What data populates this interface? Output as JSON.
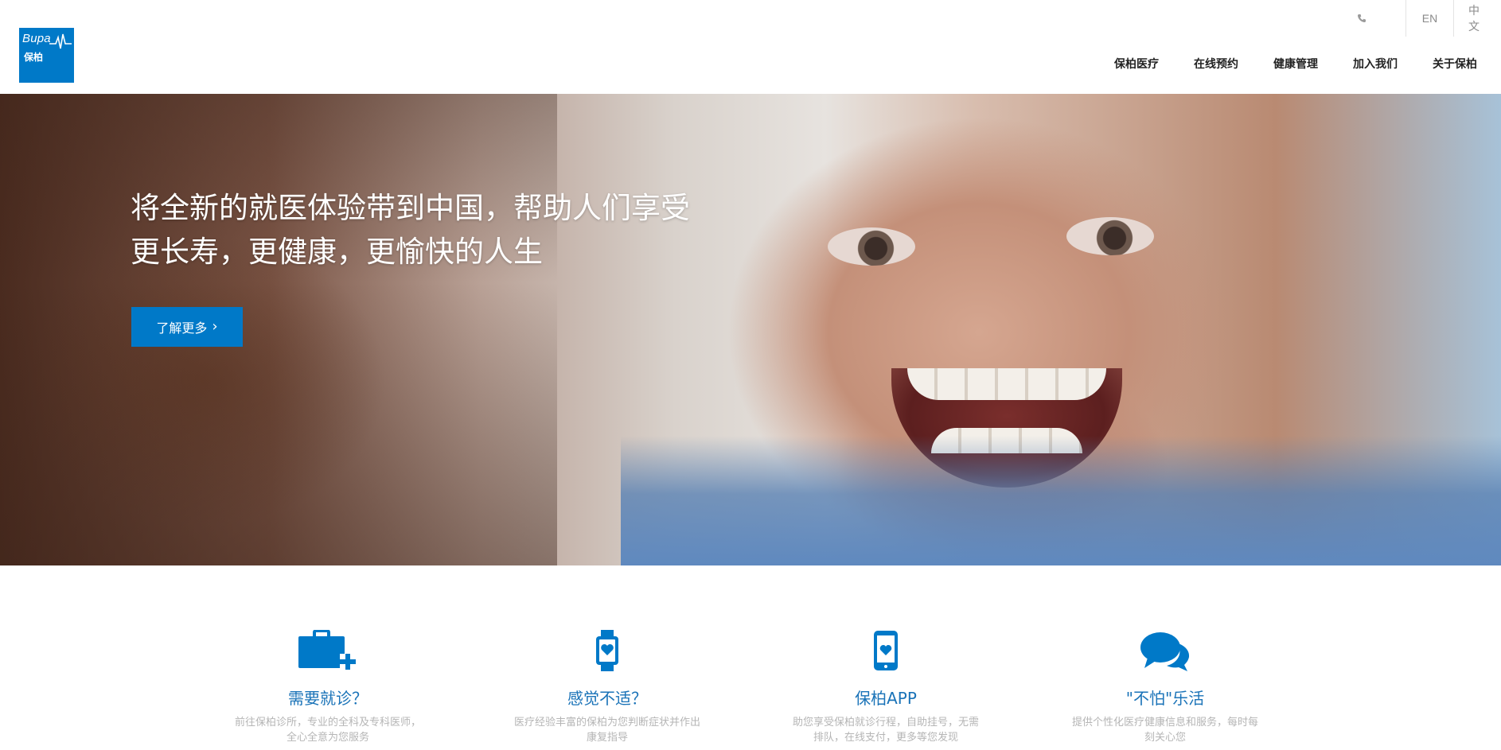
{
  "header": {
    "logo": {
      "brand": "Bupa",
      "brand_cn": "保柏",
      "color": "#0079c8"
    },
    "phone_icon": "phone-icon",
    "languages": [
      "EN",
      "中文"
    ],
    "nav": [
      "保柏医疗",
      "在线预约",
      "健康管理",
      "加入我们",
      "关于保柏"
    ]
  },
  "hero": {
    "headline_line1": "将全新的就医体验带到中国，帮助人们享受",
    "headline_line2": "更长寿，更健康，更愉快的人生",
    "cta_label": "了解更多",
    "cta_chevron": "›"
  },
  "services": [
    {
      "icon": "medical-kit-icon",
      "title": "需要就诊？",
      "desc": "前往保柏诊所，专业的全科及专科医师，全心全意为您服务"
    },
    {
      "icon": "smartwatch-heart-icon",
      "title": "感觉不适？",
      "desc": "医疗经验丰富的保柏为您判断症状并作出康复指导"
    },
    {
      "icon": "phone-heart-icon",
      "title": "保柏APP",
      "desc": "助您享受保柏就诊行程，自助挂号，无需排队，在线支付，更多等您发现"
    },
    {
      "icon": "chat-bubbles-icon",
      "title": "\"不怕\"乐活",
      "desc": "提供个性化医疗健康信息和服务，每时每刻关心您"
    }
  ],
  "colors": {
    "accent": "#0079c8",
    "service_title": "#1a73b8",
    "muted": "#b5b5b5"
  }
}
